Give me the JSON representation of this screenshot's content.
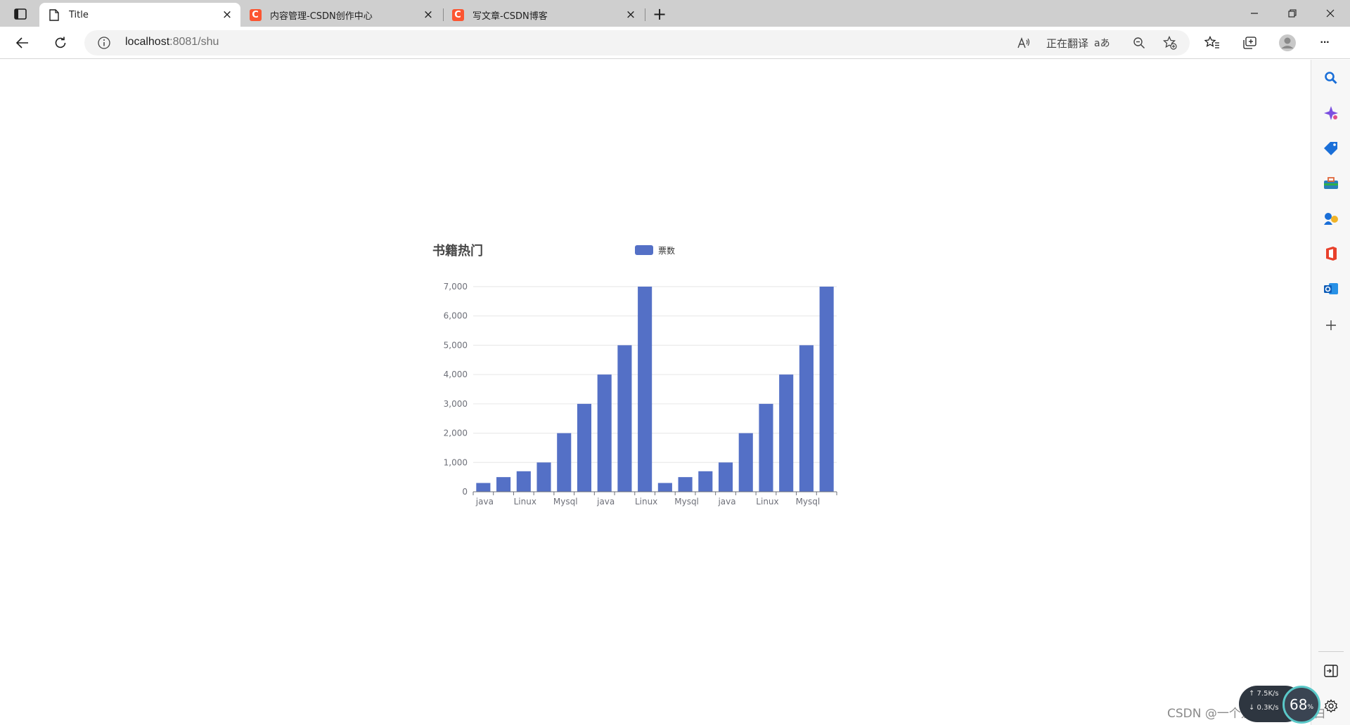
{
  "browser": {
    "tabs": [
      {
        "title": "Title",
        "icon": "page-icon",
        "active": true
      },
      {
        "title": "内容管理-CSDN创作中心",
        "icon": "csdn-logo",
        "active": false
      },
      {
        "title": "写文章-CSDN博客",
        "icon": "csdn-logo",
        "active": false
      }
    ],
    "csdn_letter": "C",
    "new_tab_glyph": "+",
    "close_glyph": "×",
    "address": {
      "host": "localhost",
      "rest": ":8081/shu"
    },
    "translate_label": "正在翻译",
    "translate_glyph": "aあ",
    "more_glyph": "···"
  },
  "sidebar": {
    "items": [
      "search-icon",
      "copilot-icon",
      "shopping-icon",
      "tools-icon",
      "games-icon",
      "office-icon",
      "outlook-icon",
      "add-icon"
    ],
    "bottom": [
      "split-screen-icon",
      "settings-icon"
    ]
  },
  "chart_data": {
    "type": "bar",
    "title": "书籍热门",
    "legend": [
      "票数"
    ],
    "legend_position": "top-center",
    "categories": [
      "java",
      "",
      "Linux",
      "",
      "Mysql",
      "",
      "java",
      "",
      "Linux",
      "",
      "Mysql",
      "",
      "java",
      "",
      "Linux",
      "",
      "Mysql",
      ""
    ],
    "series": [
      {
        "name": "票数",
        "values": [
          300,
          500,
          700,
          1000,
          2000,
          3000,
          4000,
          5000,
          7000,
          300,
          500,
          700,
          1000,
          2000,
          3000,
          4000,
          5000,
          7000
        ]
      }
    ],
    "ylim": [
      0,
      7000
    ],
    "yticks": [
      "0",
      "1,000",
      "2,000",
      "3,000",
      "4,000",
      "5,000",
      "6,000",
      "7,000"
    ],
    "grid": true,
    "bar_color": "#5470c6"
  },
  "overlay": {
    "watermark": "CSDN @一个爱学java的小白",
    "net_up": "↑ 7.5K/s",
    "net_down": "↓ 0.3K/s",
    "cpu_percent": "68",
    "cpu_unit": "%"
  },
  "colors": {
    "tabstrip_bg": "#cfcfcf",
    "accent": "#5470c6",
    "csdn_red": "#fc5531"
  }
}
